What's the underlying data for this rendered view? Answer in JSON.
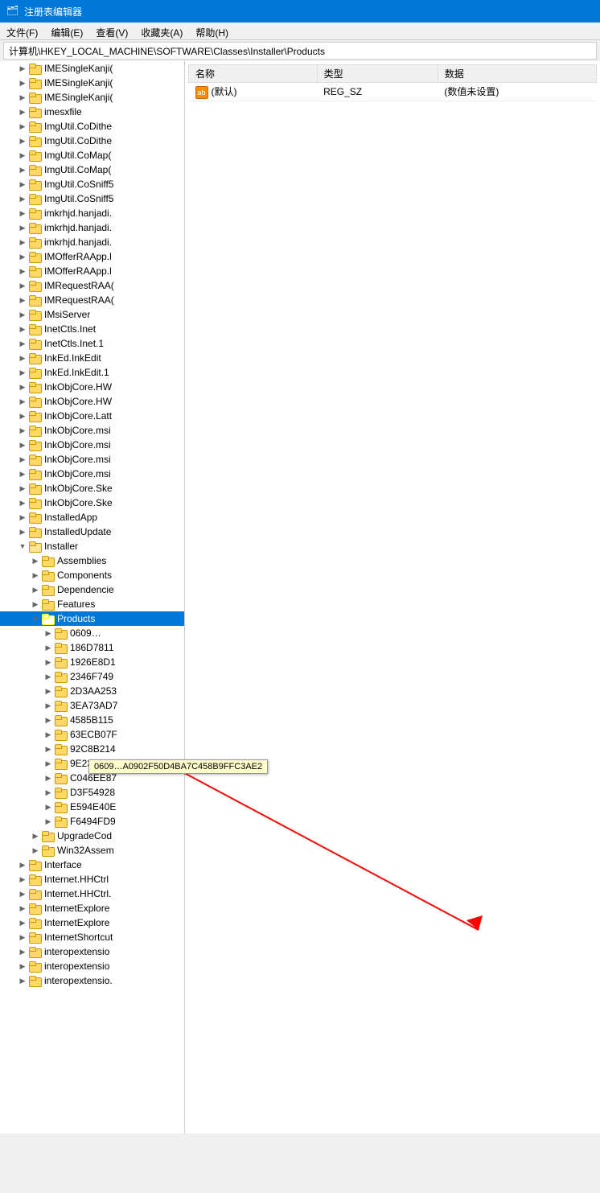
{
  "window": {
    "title": "注册表编辑器",
    "icon": "regedit"
  },
  "menubar": {
    "items": [
      {
        "label": "文件(F)",
        "key": "file"
      },
      {
        "label": "编辑(E)",
        "key": "edit"
      },
      {
        "label": "查看(V)",
        "key": "view"
      },
      {
        "label": "收藏夹(A)",
        "key": "favorites"
      },
      {
        "label": "帮助(H)",
        "key": "help"
      }
    ]
  },
  "address_bar": {
    "label": "计算机\\HKEY_LOCAL_MACHINE\\SOFTWARE\\Classes\\Installer\\Products"
  },
  "left_tree": {
    "items": [
      {
        "id": "IMESingleKanji1",
        "label": "IMESingleKanji(",
        "indent": 2,
        "expanded": false
      },
      {
        "id": "IMESingleKanji2",
        "label": "IMESingleKanji(",
        "indent": 2,
        "expanded": false
      },
      {
        "id": "IMESingleKanji3",
        "label": "IMESingleKanji(",
        "indent": 2,
        "expanded": false
      },
      {
        "id": "imesxfile",
        "label": "imesxfile",
        "indent": 2,
        "expanded": false
      },
      {
        "id": "ImgUtil1",
        "label": "ImgUtil.CoDithe",
        "indent": 2,
        "expanded": false
      },
      {
        "id": "ImgUtil2",
        "label": "ImgUtil.CoDithe",
        "indent": 2,
        "expanded": false
      },
      {
        "id": "ImgUtil3",
        "label": "ImgUtil.CoMap(",
        "indent": 2,
        "expanded": false
      },
      {
        "id": "ImgUtil4",
        "label": "ImgUtil.CoMap(",
        "indent": 2,
        "expanded": false
      },
      {
        "id": "ImgUtil5",
        "label": "ImgUtil.CoSniff5",
        "indent": 2,
        "expanded": false
      },
      {
        "id": "ImgUtil6",
        "label": "ImgUtil.CoSniff5",
        "indent": 2,
        "expanded": false
      },
      {
        "id": "imkrhjd1",
        "label": "imkrhjd.hanjadi.",
        "indent": 2,
        "expanded": false
      },
      {
        "id": "imkrhjd2",
        "label": "imkrhjd.hanjadi.",
        "indent": 2,
        "expanded": false
      },
      {
        "id": "imkrhjd3",
        "label": "imkrhjd.hanjadi.",
        "indent": 2,
        "expanded": false
      },
      {
        "id": "IMOfferRAApp1",
        "label": "IMOfferRAApp.l",
        "indent": 2,
        "expanded": false
      },
      {
        "id": "IMOfferRAApp2",
        "label": "IMOfferRAApp.l",
        "indent": 2,
        "expanded": false
      },
      {
        "id": "IMRequestRAApp1",
        "label": "IMRequestRAA(",
        "indent": 2,
        "expanded": false
      },
      {
        "id": "IMRequestRAApp2",
        "label": "IMRequestRAA(",
        "indent": 2,
        "expanded": false
      },
      {
        "id": "IMsiServer",
        "label": "IMsiServer",
        "indent": 2,
        "expanded": false
      },
      {
        "id": "InetCtls",
        "label": "InetCtls.Inet",
        "indent": 2,
        "expanded": false
      },
      {
        "id": "InetCtls1",
        "label": "InetCtls.Inet.1",
        "indent": 2,
        "expanded": false
      },
      {
        "id": "InkEd",
        "label": "InkEd.InkEdit",
        "indent": 2,
        "expanded": false
      },
      {
        "id": "InkEd1",
        "label": "InkEd.InkEdit.1",
        "indent": 2,
        "expanded": false
      },
      {
        "id": "InkObjCore1",
        "label": "InkObjCore.HW",
        "indent": 2,
        "expanded": false
      },
      {
        "id": "InkObjCore2",
        "label": "InkObjCore.HW",
        "indent": 2,
        "expanded": false
      },
      {
        "id": "InkObjCore3",
        "label": "InkObjCore.Latt",
        "indent": 2,
        "expanded": false
      },
      {
        "id": "InkObjCore4",
        "label": "InkObjCore.msi",
        "indent": 2,
        "expanded": false
      },
      {
        "id": "InkObjCore5",
        "label": "InkObjCore.msi",
        "indent": 2,
        "expanded": false
      },
      {
        "id": "InkObjCore6",
        "label": "InkObjCore.msi",
        "indent": 2,
        "expanded": false
      },
      {
        "id": "InkObjCore7",
        "label": "InkObjCore.msi",
        "indent": 2,
        "expanded": false
      },
      {
        "id": "InkObjCore8",
        "label": "InkObjCore.Ske",
        "indent": 2,
        "expanded": false
      },
      {
        "id": "InkObjCore9",
        "label": "InkObjCore.Ske",
        "indent": 2,
        "expanded": false
      },
      {
        "id": "InstalledApp",
        "label": "InstalledApp",
        "indent": 2,
        "expanded": false
      },
      {
        "id": "InstalledUpdate",
        "label": "InstalledUpdate",
        "indent": 2,
        "expanded": false
      },
      {
        "id": "Installer",
        "label": "Installer",
        "indent": 2,
        "expanded": true
      },
      {
        "id": "Assemblies",
        "label": "Assemblies",
        "indent": 3,
        "expanded": false
      },
      {
        "id": "Components",
        "label": "Components",
        "indent": 3,
        "expanded": false
      },
      {
        "id": "Dependencies",
        "label": "Dependencie",
        "indent": 3,
        "expanded": false
      },
      {
        "id": "Features",
        "label": "Features",
        "indent": 3,
        "expanded": false
      },
      {
        "id": "Products",
        "label": "Products",
        "indent": 3,
        "expanded": true,
        "selected": true
      },
      {
        "id": "prod1",
        "label": "0609…",
        "indent": 4,
        "expanded": false
      },
      {
        "id": "prod2",
        "label": "186D7811",
        "indent": 4,
        "expanded": false
      },
      {
        "id": "prod3",
        "label": "1926E8D1",
        "indent": 4,
        "expanded": false
      },
      {
        "id": "prod4",
        "label": "2346F749",
        "indent": 4,
        "expanded": false
      },
      {
        "id": "prod5",
        "label": "2D3AA253",
        "indent": 4,
        "expanded": false
      },
      {
        "id": "prod6",
        "label": "3EA73AD7",
        "indent": 4,
        "expanded": false
      },
      {
        "id": "prod7",
        "label": "4585B115",
        "indent": 4,
        "expanded": false
      },
      {
        "id": "prod8",
        "label": "63ECB07F",
        "indent": 4,
        "expanded": false
      },
      {
        "id": "prod9",
        "label": "92C8B214",
        "indent": 4,
        "expanded": false
      },
      {
        "id": "prod10",
        "label": "9E2353D6",
        "indent": 4,
        "expanded": false
      },
      {
        "id": "prod11",
        "label": "C046EE87",
        "indent": 4,
        "expanded": false
      },
      {
        "id": "prod12",
        "label": "D3F54928",
        "indent": 4,
        "expanded": false
      },
      {
        "id": "prod13",
        "label": "E594E40E",
        "indent": 4,
        "expanded": false
      },
      {
        "id": "prod14",
        "label": "F6494FD9",
        "indent": 4,
        "expanded": false
      },
      {
        "id": "UpgradeCod",
        "label": "UpgradeCod",
        "indent": 3,
        "expanded": false
      },
      {
        "id": "Win32Assem",
        "label": "Win32Assem",
        "indent": 3,
        "expanded": false
      },
      {
        "id": "Interface",
        "label": "Interface",
        "indent": 2,
        "expanded": false
      },
      {
        "id": "InternetHHCtrl",
        "label": "Internet.HHCtrl",
        "indent": 2,
        "expanded": false
      },
      {
        "id": "InternetHHCtrl1",
        "label": "Internet.HHCtrl.",
        "indent": 2,
        "expanded": false
      },
      {
        "id": "InternetExplorer1",
        "label": "InternetExplore",
        "indent": 2,
        "expanded": false
      },
      {
        "id": "InternetExplorer2",
        "label": "InternetExplore",
        "indent": 2,
        "expanded": false
      },
      {
        "id": "InternetShortcut",
        "label": "InternetShortcut",
        "indent": 2,
        "expanded": false
      },
      {
        "id": "interopextensio1",
        "label": "interopextensio",
        "indent": 2,
        "expanded": false
      },
      {
        "id": "interopextensio2",
        "label": "interopextensio",
        "indent": 2,
        "expanded": false
      },
      {
        "id": "interopextensio3",
        "label": "interopextensio.",
        "indent": 2,
        "expanded": false
      }
    ]
  },
  "right_panel": {
    "columns": [
      "名称",
      "类型",
      "数据"
    ],
    "rows": [
      {
        "name": "(默认)",
        "icon": "ab",
        "type": "REG_SZ",
        "data": "(数值未设置)"
      }
    ]
  },
  "tooltip": {
    "text": "0609…A0902F50D4BA7C458B9FFC3AE2"
  }
}
